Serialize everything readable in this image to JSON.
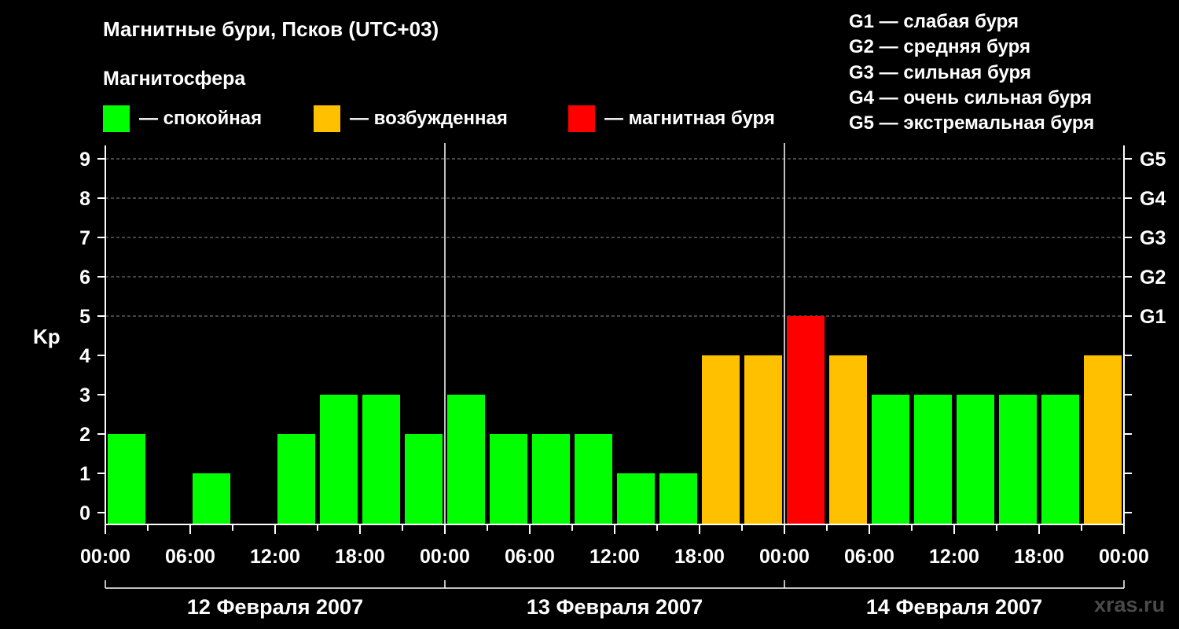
{
  "header": {
    "title": "Магнитные бури, Псков (UTC+03)",
    "subtitle": "Магнитосфера"
  },
  "legend": [
    {
      "label": "— спокойная",
      "color": "#00ff00"
    },
    {
      "label": "— возбужденная",
      "color": "#ffc000"
    },
    {
      "label": "— магнитная буря",
      "color": "#ff0000"
    }
  ],
  "storm_levels": [
    "G1 — слабая буря",
    "G2 — средняя буря",
    "G3 — сильная буря",
    "G4 — очень сильная буря",
    "G5 — экстремальная буря"
  ],
  "watermark": "xras.ru",
  "chart_data": {
    "type": "bar",
    "ylabel": "Kp",
    "ylim": [
      0,
      9
    ],
    "yticks": [
      0,
      1,
      2,
      3,
      4,
      5,
      6,
      7,
      8,
      9
    ],
    "right_ticks": [
      {
        "value": 5,
        "label": "G1"
      },
      {
        "value": 6,
        "label": "G2"
      },
      {
        "value": 7,
        "label": "G3"
      },
      {
        "value": 8,
        "label": "G4"
      },
      {
        "value": 9,
        "label": "G5"
      }
    ],
    "grid": "dashed horizontal at Kp 5–9",
    "xtick_labels": [
      "00:00",
      "06:00",
      "12:00",
      "18:00",
      "00:00",
      "06:00",
      "12:00",
      "18:00",
      "00:00",
      "06:00",
      "12:00",
      "18:00",
      "00:00"
    ],
    "days": [
      "12 Февраля 2007",
      "13 Февраля 2007",
      "14 Февраля 2007"
    ],
    "interval_hours": 3,
    "values": [
      2,
      0,
      1,
      0,
      2,
      3,
      3,
      2,
      3,
      2,
      2,
      2,
      1,
      1,
      4,
      4,
      5,
      4,
      3,
      3,
      3,
      3,
      3,
      4
    ],
    "colors": {
      "quiet": "#00ff00",
      "active": "#ffc000",
      "storm": "#ff0000"
    },
    "thresholds": {
      "active_from": 4,
      "storm_from": 5
    }
  }
}
